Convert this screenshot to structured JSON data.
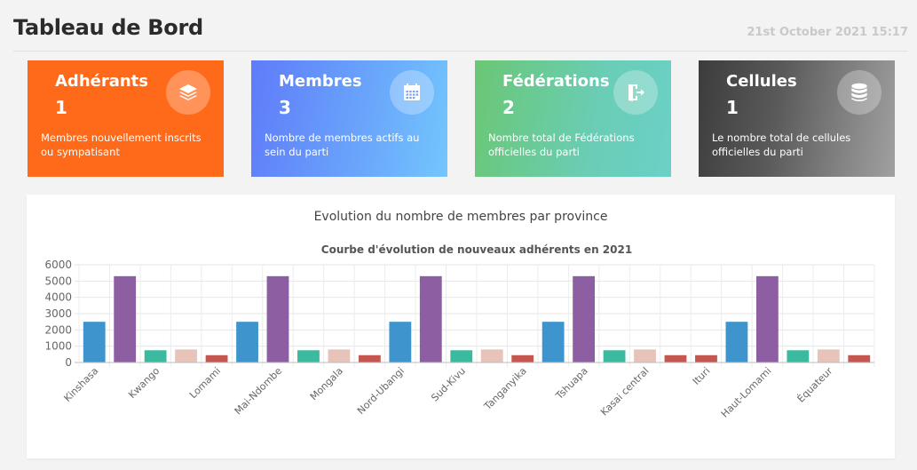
{
  "header": {
    "title": "Tableau de Bord",
    "datetime": "21st October 2021 15:17"
  },
  "cards": [
    {
      "title": "Adhérants",
      "value": "1",
      "description": "Membres nouvellement inscrits ou sympatisant",
      "icon": "layers-icon"
    },
    {
      "title": "Membres",
      "value": "3",
      "description": "Nombre de membres actifs au sein du parti",
      "icon": "calendar-icon"
    },
    {
      "title": "Fédérations",
      "value": "2",
      "description": "Nombre total de Fédérations officielles du parti",
      "icon": "exit-door-icon"
    },
    {
      "title": "Cellules",
      "value": "1",
      "description": "Le nombre total de cellules officielles du parti",
      "icon": "database-icon"
    }
  ],
  "panel": {
    "title": "Evolution du nombre de membres par province"
  },
  "chart_data": {
    "type": "bar",
    "title": "Courbe d'évolution de nouveaux adhérents en 2021",
    "xlabel": "",
    "ylabel": "",
    "ylim": [
      0,
      6000
    ],
    "yticks": [
      0,
      1000,
      2000,
      3000,
      4000,
      5000,
      6000
    ],
    "grid": true,
    "categories": [
      "Kinshasa",
      "Kwango",
      "Lomami",
      "Mai-Ndombe",
      "Mongala",
      "Nord-Ubangi",
      "Sud-Kivu",
      "Tanganyika",
      "Tshuapa",
      "Kasai central",
      "Ituri",
      "Haut-Lomami",
      "Équateur"
    ],
    "bars": [
      {
        "value": 2500,
        "color": "#3e95cd"
      },
      {
        "value": 5300,
        "color": "#8e5ea2"
      },
      {
        "value": 750,
        "color": "#3cba9f"
      },
      {
        "value": 800,
        "color": "#e8c3b9"
      },
      {
        "value": 450,
        "color": "#c45850"
      },
      {
        "value": 2500,
        "color": "#3e95cd"
      },
      {
        "value": 5300,
        "color": "#8e5ea2"
      },
      {
        "value": 750,
        "color": "#3cba9f"
      },
      {
        "value": 800,
        "color": "#e8c3b9"
      },
      {
        "value": 450,
        "color": "#c45850"
      },
      {
        "value": 2500,
        "color": "#3e95cd"
      },
      {
        "value": 5300,
        "color": "#8e5ea2"
      },
      {
        "value": 750,
        "color": "#3cba9f"
      },
      {
        "value": 800,
        "color": "#e8c3b9"
      },
      {
        "value": 450,
        "color": "#c45850"
      },
      {
        "value": 2500,
        "color": "#3e95cd"
      },
      {
        "value": 5300,
        "color": "#8e5ea2"
      },
      {
        "value": 750,
        "color": "#3cba9f"
      },
      {
        "value": 800,
        "color": "#e8c3b9"
      },
      {
        "value": 450,
        "color": "#c45850"
      },
      {
        "value": 450,
        "color": "#c45850"
      },
      {
        "value": 2500,
        "color": "#3e95cd"
      },
      {
        "value": 5300,
        "color": "#8e5ea2"
      },
      {
        "value": 750,
        "color": "#3cba9f"
      },
      {
        "value": 800,
        "color": "#e8c3b9"
      },
      {
        "value": 450,
        "color": "#c45850"
      }
    ]
  },
  "colors": {
    "card1": "#ff6a1a",
    "card2": "#6aa7fb",
    "card3": "#6acdb4",
    "card4": "#5a5a5a"
  }
}
